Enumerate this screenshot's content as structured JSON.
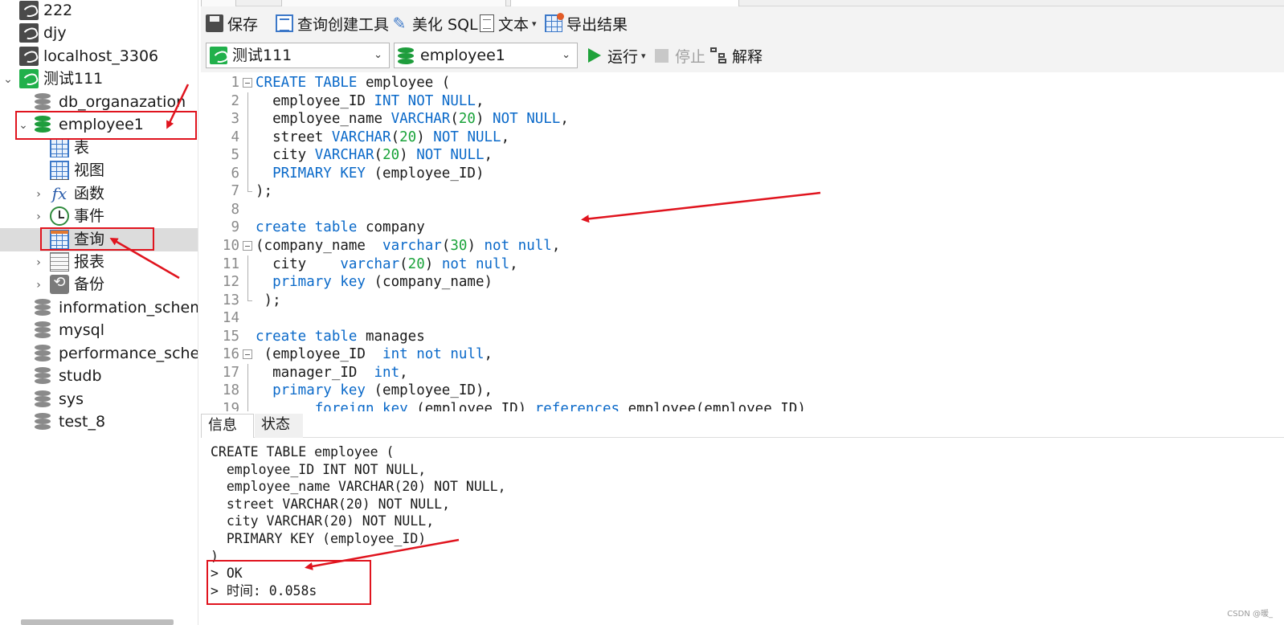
{
  "sidebar": {
    "items": [
      {
        "label": "222",
        "icon": "connection-icon",
        "level": 0
      },
      {
        "label": "djy",
        "icon": "connection-icon",
        "level": 0
      },
      {
        "label": "localhost_3306",
        "icon": "connection-icon",
        "level": 0
      },
      {
        "label": "测试111",
        "icon": "connection-icon-green",
        "level": 0,
        "expanded": true
      },
      {
        "label": "db_organazation",
        "icon": "database-icon",
        "level": 1
      },
      {
        "label": "employee1",
        "icon": "database-icon-green",
        "level": 1,
        "expanded": true
      },
      {
        "label": "表",
        "icon": "table-icon",
        "level": 2
      },
      {
        "label": "视图",
        "icon": "view-icon",
        "level": 2
      },
      {
        "label": "函数",
        "icon": "function-icon",
        "level": 2,
        "collapsed": true
      },
      {
        "label": "事件",
        "icon": "event-icon",
        "level": 2,
        "collapsed": true
      },
      {
        "label": "查询",
        "icon": "query-icon",
        "level": 2,
        "selected": true
      },
      {
        "label": "报表",
        "icon": "report-icon",
        "level": 2,
        "collapsed": true
      },
      {
        "label": "备份",
        "icon": "backup-icon",
        "level": 2,
        "collapsed": true
      },
      {
        "label": "information_schema",
        "icon": "database-icon",
        "level": 1
      },
      {
        "label": "mysql",
        "icon": "database-icon",
        "level": 1
      },
      {
        "label": "performance_schema",
        "icon": "database-icon",
        "level": 1
      },
      {
        "label": "studb",
        "icon": "database-icon",
        "level": 1
      },
      {
        "label": "sys",
        "icon": "database-icon",
        "level": 1
      },
      {
        "label": "test_8",
        "icon": "database-icon",
        "level": 1
      }
    ]
  },
  "toolbar": {
    "save": "保存",
    "query_builder": "查询创建工具",
    "beautify": "美化 SQL",
    "text": "文本",
    "export": "导出结果"
  },
  "query_bar": {
    "connection": "测试111",
    "database": "employee1",
    "run": "运行",
    "stop": "停止",
    "explain": "解释"
  },
  "editor": {
    "lines": [
      {
        "n": "1",
        "tokens": [
          [
            "kw",
            "CREATE TABLE"
          ],
          [
            "t",
            " employee ("
          ]
        ]
      },
      {
        "n": "2",
        "tokens": [
          [
            "t",
            "  employee_ID "
          ],
          [
            "kw",
            "INT NOT NULL"
          ],
          [
            "t",
            ","
          ]
        ]
      },
      {
        "n": "3",
        "tokens": [
          [
            "t",
            "  employee_name "
          ],
          [
            "kw",
            "VARCHAR"
          ],
          [
            "t",
            "("
          ],
          [
            "num",
            "20"
          ],
          [
            "t",
            ") "
          ],
          [
            "kw",
            "NOT NULL"
          ],
          [
            "t",
            ","
          ]
        ]
      },
      {
        "n": "4",
        "tokens": [
          [
            "t",
            "  street "
          ],
          [
            "kw",
            "VARCHAR"
          ],
          [
            "t",
            "("
          ],
          [
            "num",
            "20"
          ],
          [
            "t",
            ") "
          ],
          [
            "kw",
            "NOT NULL"
          ],
          [
            "t",
            ","
          ]
        ]
      },
      {
        "n": "5",
        "tokens": [
          [
            "t",
            "  city "
          ],
          [
            "kw",
            "VARCHAR"
          ],
          [
            "t",
            "("
          ],
          [
            "num",
            "20"
          ],
          [
            "t",
            ") "
          ],
          [
            "kw",
            "NOT NULL"
          ],
          [
            "t",
            ","
          ]
        ]
      },
      {
        "n": "6",
        "tokens": [
          [
            "t",
            "  "
          ],
          [
            "kw",
            "PRIMARY KEY"
          ],
          [
            "t",
            " (employee_ID)"
          ]
        ]
      },
      {
        "n": "7",
        "tokens": [
          [
            "t",
            ");"
          ]
        ]
      },
      {
        "n": "8",
        "tokens": []
      },
      {
        "n": "9",
        "tokens": [
          [
            "kw",
            "create table"
          ],
          [
            "t",
            " company"
          ]
        ]
      },
      {
        "n": "10",
        "tokens": [
          [
            "t",
            "(company_name  "
          ],
          [
            "kw",
            "varchar"
          ],
          [
            "t",
            "("
          ],
          [
            "num",
            "30"
          ],
          [
            "t",
            ") "
          ],
          [
            "kw",
            "not null"
          ],
          [
            "t",
            ","
          ]
        ]
      },
      {
        "n": "11",
        "tokens": [
          [
            "t",
            "  city    "
          ],
          [
            "kw",
            "varchar"
          ],
          [
            "t",
            "("
          ],
          [
            "num",
            "20"
          ],
          [
            "t",
            ") "
          ],
          [
            "kw",
            "not null"
          ],
          [
            "t",
            ","
          ]
        ]
      },
      {
        "n": "12",
        "tokens": [
          [
            "t",
            "  "
          ],
          [
            "kw",
            "primary key"
          ],
          [
            "t",
            " (company_name)"
          ]
        ]
      },
      {
        "n": "13",
        "tokens": [
          [
            "t",
            " );"
          ]
        ]
      },
      {
        "n": "14",
        "tokens": []
      },
      {
        "n": "15",
        "tokens": [
          [
            "kw",
            "create table"
          ],
          [
            "t",
            " manages"
          ]
        ]
      },
      {
        "n": "16",
        "tokens": [
          [
            "t",
            " (employee_ID  "
          ],
          [
            "kw",
            "int not null"
          ],
          [
            "t",
            ","
          ]
        ]
      },
      {
        "n": "17",
        "tokens": [
          [
            "t",
            "  manager_ID  "
          ],
          [
            "kw",
            "int"
          ],
          [
            "t",
            ","
          ]
        ]
      },
      {
        "n": "18",
        "tokens": [
          [
            "t",
            "  "
          ],
          [
            "kw",
            "primary key"
          ],
          [
            "t",
            " (employee_ID),"
          ]
        ]
      },
      {
        "n": "19",
        "tokens": [
          [
            "t",
            "       "
          ],
          [
            "kw",
            "foreign key"
          ],
          [
            "t",
            " (employee_ID) "
          ],
          [
            "kw",
            "references"
          ],
          [
            "t",
            " employee(employee_ID)"
          ]
        ]
      }
    ]
  },
  "result_tabs": {
    "info": "信息",
    "status": "状态"
  },
  "messages": [
    "CREATE TABLE employee (",
    "  employee_ID INT NOT NULL,",
    "  employee_name VARCHAR(20) NOT NULL,",
    "  street VARCHAR(20) NOT NULL,",
    "  city VARCHAR(20) NOT NULL,",
    "  PRIMARY KEY (employee_ID)",
    ")",
    "> OK",
    "> 时间: 0.058s"
  ],
  "watermark": "CSDN @暖_",
  "colors": {
    "accent_green": "#1fa23a",
    "keyword_blue": "#0a69c9",
    "number_green": "#1aa33a",
    "annotation_red": "#e0141e"
  }
}
